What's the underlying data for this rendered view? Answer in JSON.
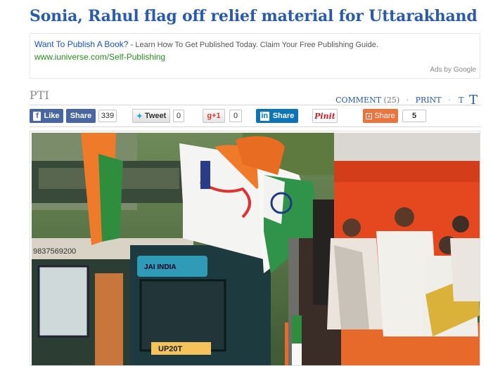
{
  "article": {
    "headline": "Sonia, Rahul flag off relief material for Uttarakhand",
    "source": "PTI"
  },
  "ad": {
    "title": "Want To Publish A Book?",
    "separator": "-",
    "description": "Learn How To Get Published Today. Claim Your Free Publishing Guide.",
    "url": "www.iuniverse.com/Self-Publishing",
    "attribution": "Ads by Google"
  },
  "tools": {
    "comment_label": "COMMENT",
    "comment_count": "(25)",
    "print_label": "PRINT",
    "text_small": "T",
    "text_large": "T",
    "dot": "·"
  },
  "share": {
    "fb_like_icon_glyph": "f",
    "fb_like": "Like",
    "fb_share": "Share",
    "fb_count": "339",
    "twitter": "Tweet",
    "twitter_count": "0",
    "gplus": "g+1",
    "gplus_count": "0",
    "linkedin_icon_glyph": "in",
    "linkedin": "Share",
    "pinterest": "Pinit",
    "sharethis": "Share",
    "sharethis_count": "5"
  },
  "photo": {
    "truck_lettering": "UP20T",
    "truck_number": "9837569200",
    "truck_slogan": "JAI INDIA"
  },
  "colors": {
    "headline": "#2a5aa8",
    "ad_title": "#1a4fb3",
    "ad_url": "#2a8a22",
    "facebook": "#4a66a0",
    "linkedin": "#0d75b6",
    "sharethis": "#e9743d",
    "pinterest": "#cb2027"
  }
}
